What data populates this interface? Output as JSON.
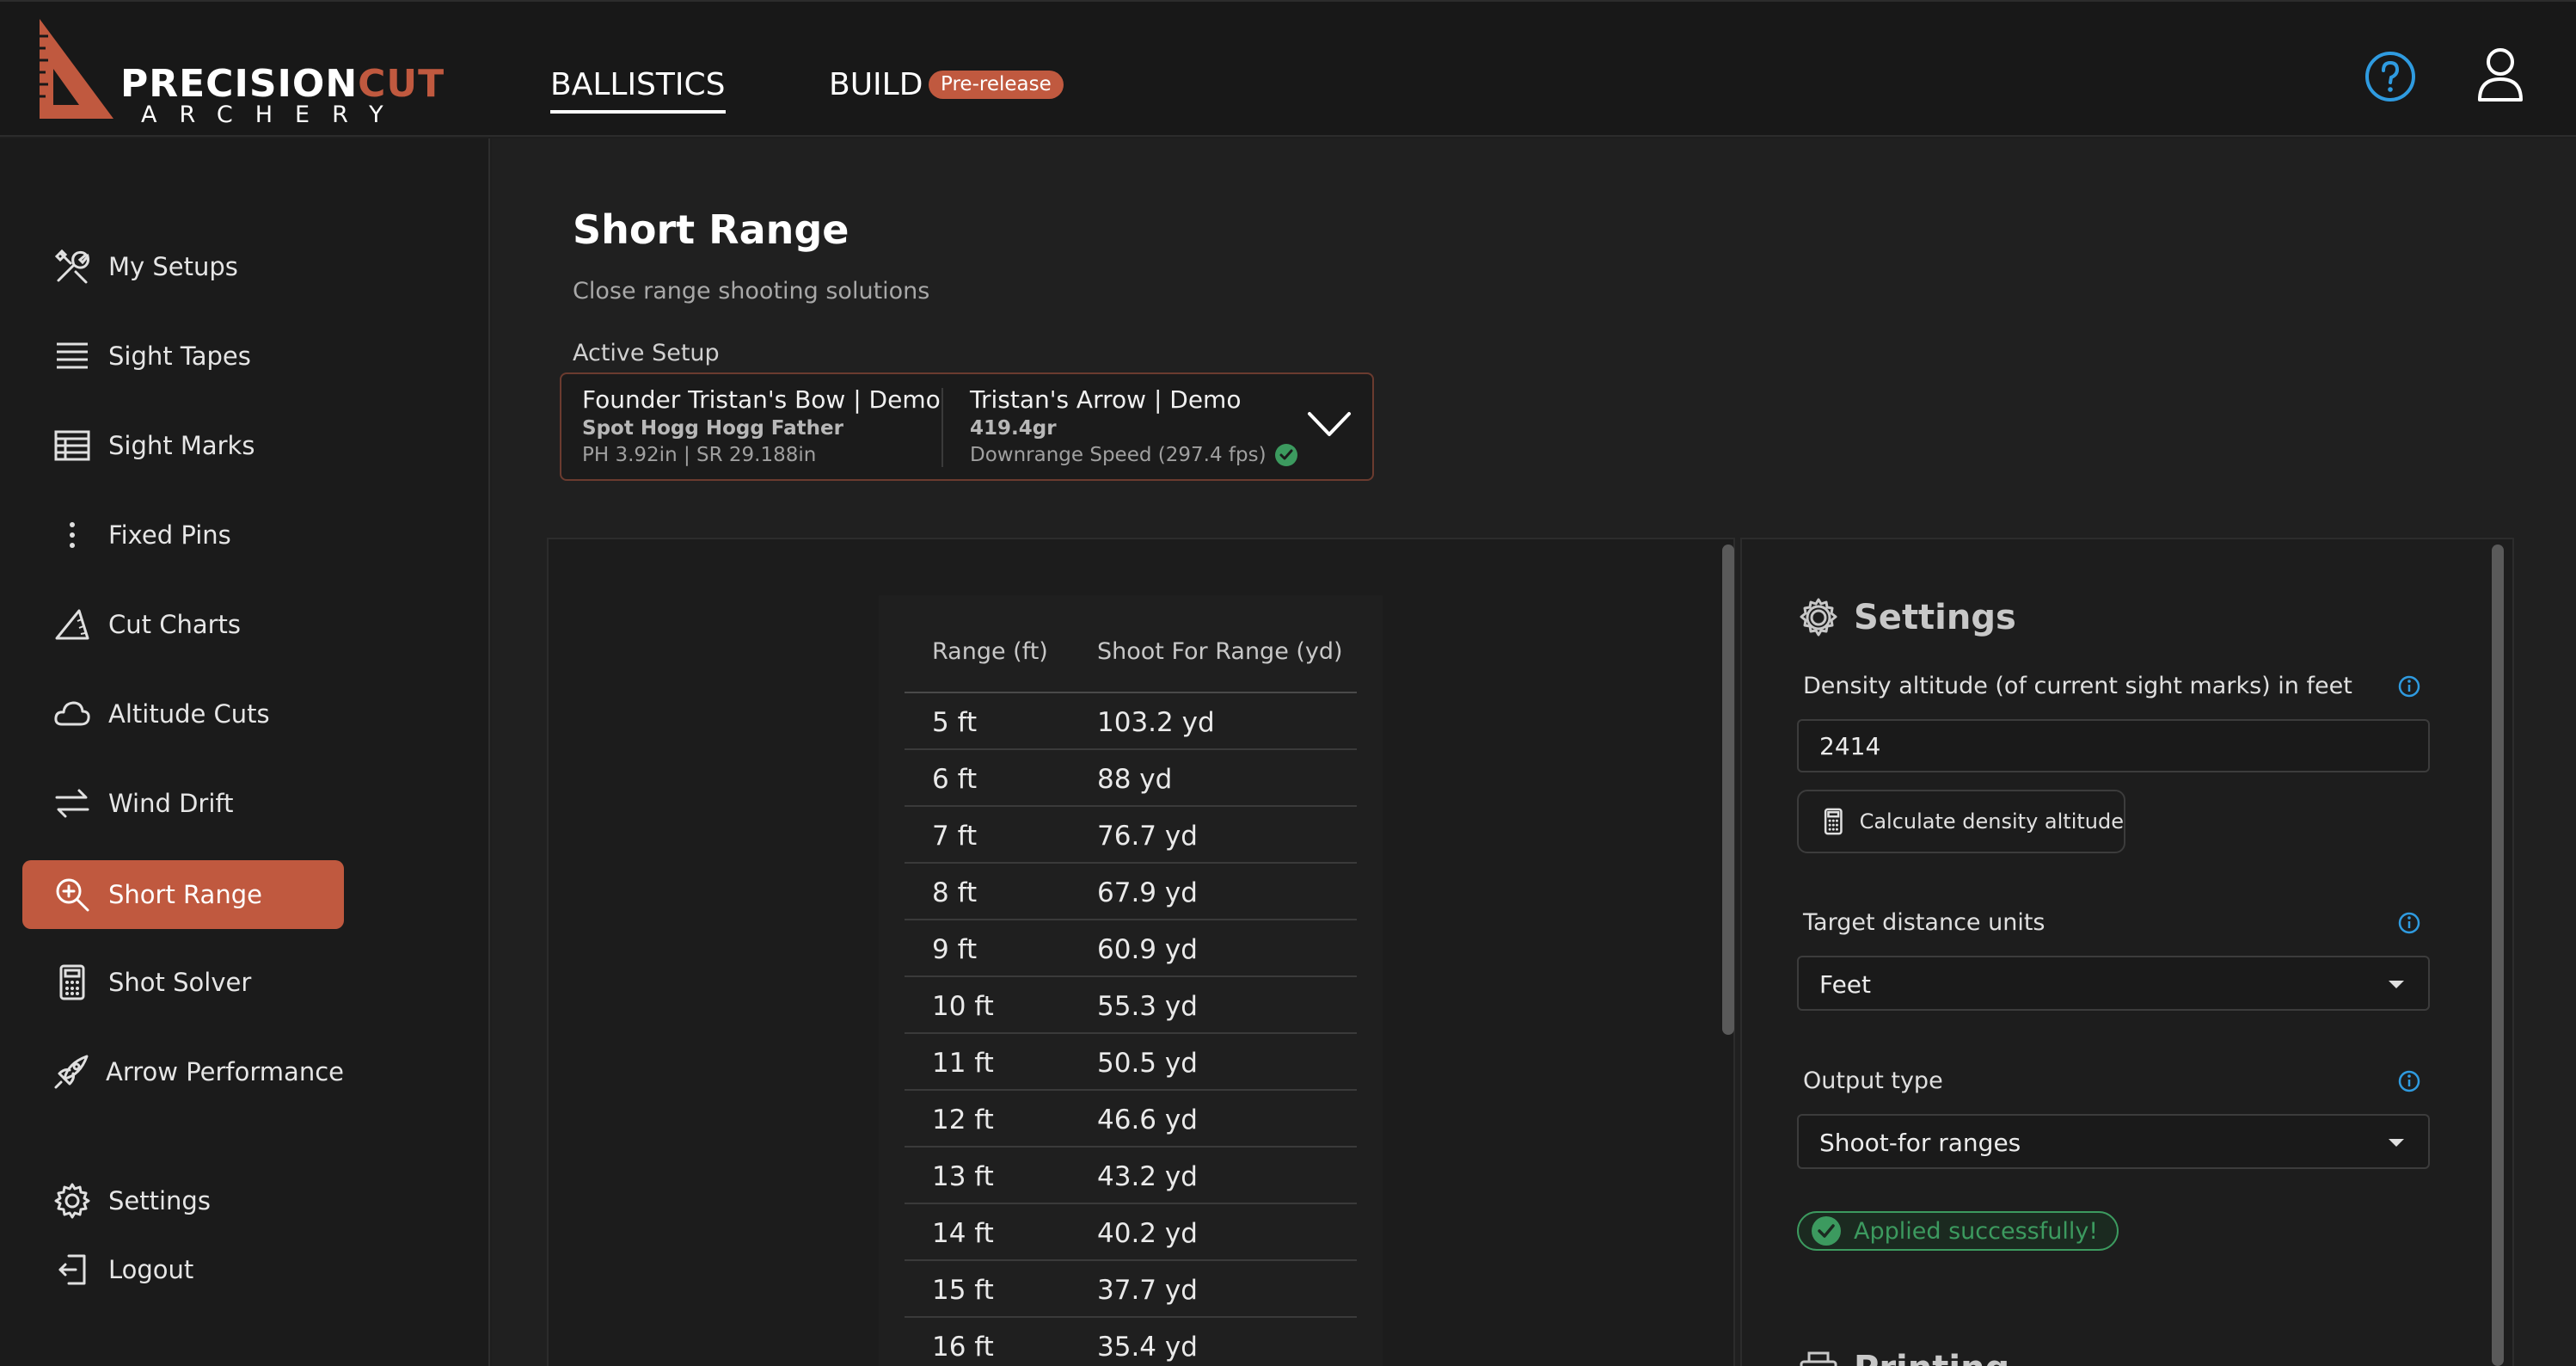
{
  "app": {
    "logo_word_a": "PRECISION",
    "logo_word_b": "CUT",
    "logo_sub": "ARCHERY",
    "accent_color": "#c0593f"
  },
  "topnav": {
    "tabs": [
      {
        "label": "BALLISTICS",
        "active": true
      },
      {
        "label": "BUILD",
        "active": false
      }
    ],
    "build_badge": "Pre-release",
    "help_icon": "help-circle-icon",
    "user_icon": "user-icon"
  },
  "sidebar": {
    "items": [
      {
        "label": "My Setups",
        "icon": "tools-icon",
        "active": false
      },
      {
        "label": "Sight Tapes",
        "icon": "lines-icon",
        "active": false
      },
      {
        "label": "Sight Marks",
        "icon": "table-icon",
        "active": false
      },
      {
        "label": "Fixed Pins",
        "icon": "dots-vertical-icon",
        "active": false
      },
      {
        "label": "Cut Charts",
        "icon": "triangle-ruler-icon",
        "active": false
      },
      {
        "label": "Altitude Cuts",
        "icon": "cloud-icon",
        "active": false
      },
      {
        "label": "Wind Drift",
        "icon": "arrows-exchange-icon",
        "active": false
      },
      {
        "label": "Short Range",
        "icon": "zoom-in-icon",
        "active": true
      },
      {
        "label": "Shot Solver",
        "icon": "calculator-icon",
        "active": false
      },
      {
        "label": "Arrow Performance",
        "icon": "rocket-icon",
        "active": false
      }
    ],
    "bottom": [
      {
        "label": "Settings",
        "icon": "gear-icon"
      },
      {
        "label": "Logout",
        "icon": "logout-icon"
      }
    ]
  },
  "page": {
    "title": "Short Range",
    "subtitle": "Close range shooting solutions",
    "active_setup_label": "Active Setup"
  },
  "setup": {
    "bow_name": "Founder Tristan's Bow | Demo",
    "bow_sight": "Spot Hogg Hogg Father",
    "bow_specs": "PH 3.92in | SR 29.188in",
    "arrow_name": "Tristan's Arrow | Demo",
    "arrow_weight": "419.4gr",
    "arrow_speed": "Downrange Speed (297.4 fps)"
  },
  "table": {
    "headers": [
      "Range (ft)",
      "Shoot For Range (yd)"
    ],
    "rows": [
      [
        "5 ft",
        "103.2 yd"
      ],
      [
        "6 ft",
        "88 yd"
      ],
      [
        "7 ft",
        "76.7 yd"
      ],
      [
        "8 ft",
        "67.9 yd"
      ],
      [
        "9 ft",
        "60.9 yd"
      ],
      [
        "10 ft",
        "55.3 yd"
      ],
      [
        "11 ft",
        "50.5 yd"
      ],
      [
        "12 ft",
        "46.6 yd"
      ],
      [
        "13 ft",
        "43.2 yd"
      ],
      [
        "14 ft",
        "40.2 yd"
      ],
      [
        "15 ft",
        "37.7 yd"
      ],
      [
        "16 ft",
        "35.4 yd"
      ]
    ]
  },
  "settings": {
    "title": "Settings",
    "density_label": "Density altitude (of current sight marks) in feet",
    "density_value": "2414",
    "calc_button": "Calculate density altitude",
    "target_units_label": "Target distance units",
    "target_units_value": "Feet",
    "output_type_label": "Output type",
    "output_type_value": "Shoot-for ranges",
    "success_text": "Applied successfully!",
    "success_color": "#3c9a5f"
  },
  "next_section": {
    "title": "Printing"
  }
}
